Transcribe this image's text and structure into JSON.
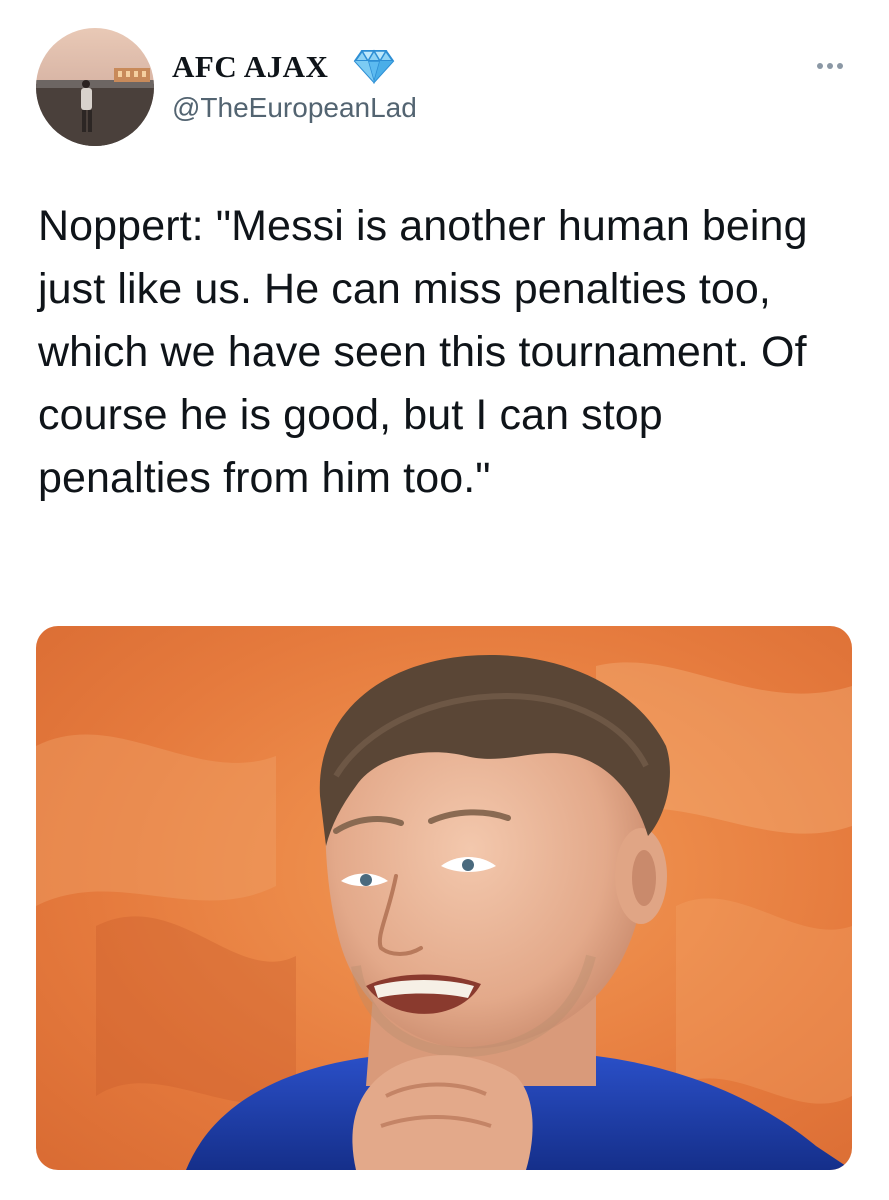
{
  "tweet": {
    "author": {
      "display_name": "AFC AJAX",
      "verified_badge_icon": "blue-diamond-icon",
      "handle": "@TheEuropeanLad",
      "avatar_icon": "profile-photo"
    },
    "more_icon": "ellipsis-icon",
    "text": "Noppert: \"Messi is another human being just like us. He can miss penalties too, which we have seen this tournament. Of course he is good, but I can stop penalties from him too.\"",
    "media": {
      "type": "photo",
      "description_icon": "press-conference-photo"
    }
  },
  "colors": {
    "text_primary": "#0f1419",
    "text_secondary": "#536471",
    "background": "#ffffff",
    "media_background": "#e8773f",
    "jersey": "#1f3fae"
  }
}
